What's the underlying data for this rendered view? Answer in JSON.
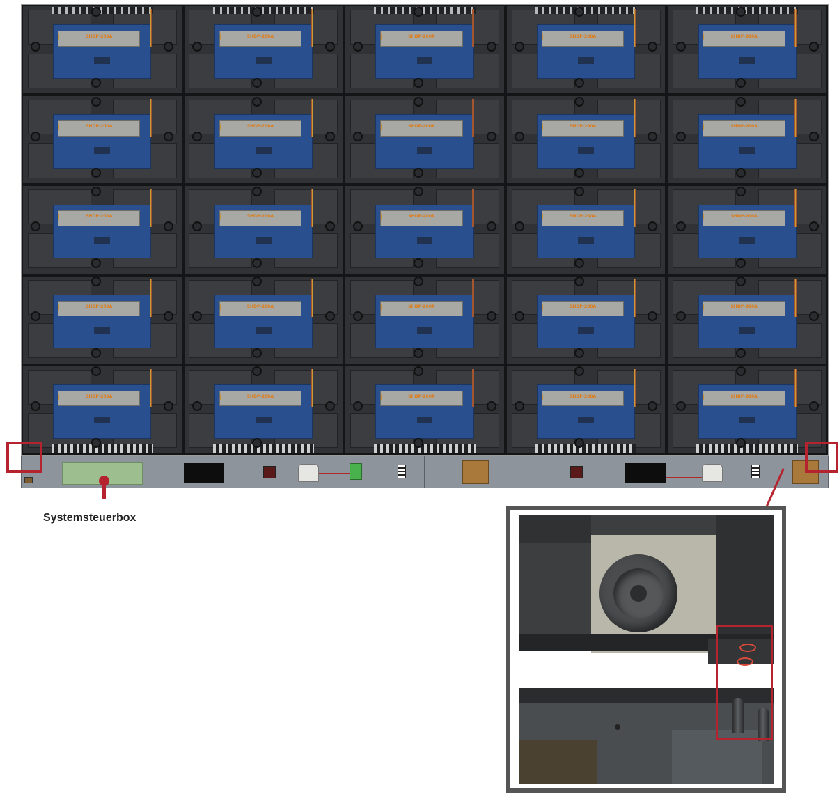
{
  "diagram": {
    "caption": "Systemsteuerbox",
    "psu_label": "SHDP-200A"
  },
  "colors": {
    "accent": "#b5232f",
    "panel_blue": "#2a4f8e",
    "control_box_green": "#9dbf8f"
  }
}
